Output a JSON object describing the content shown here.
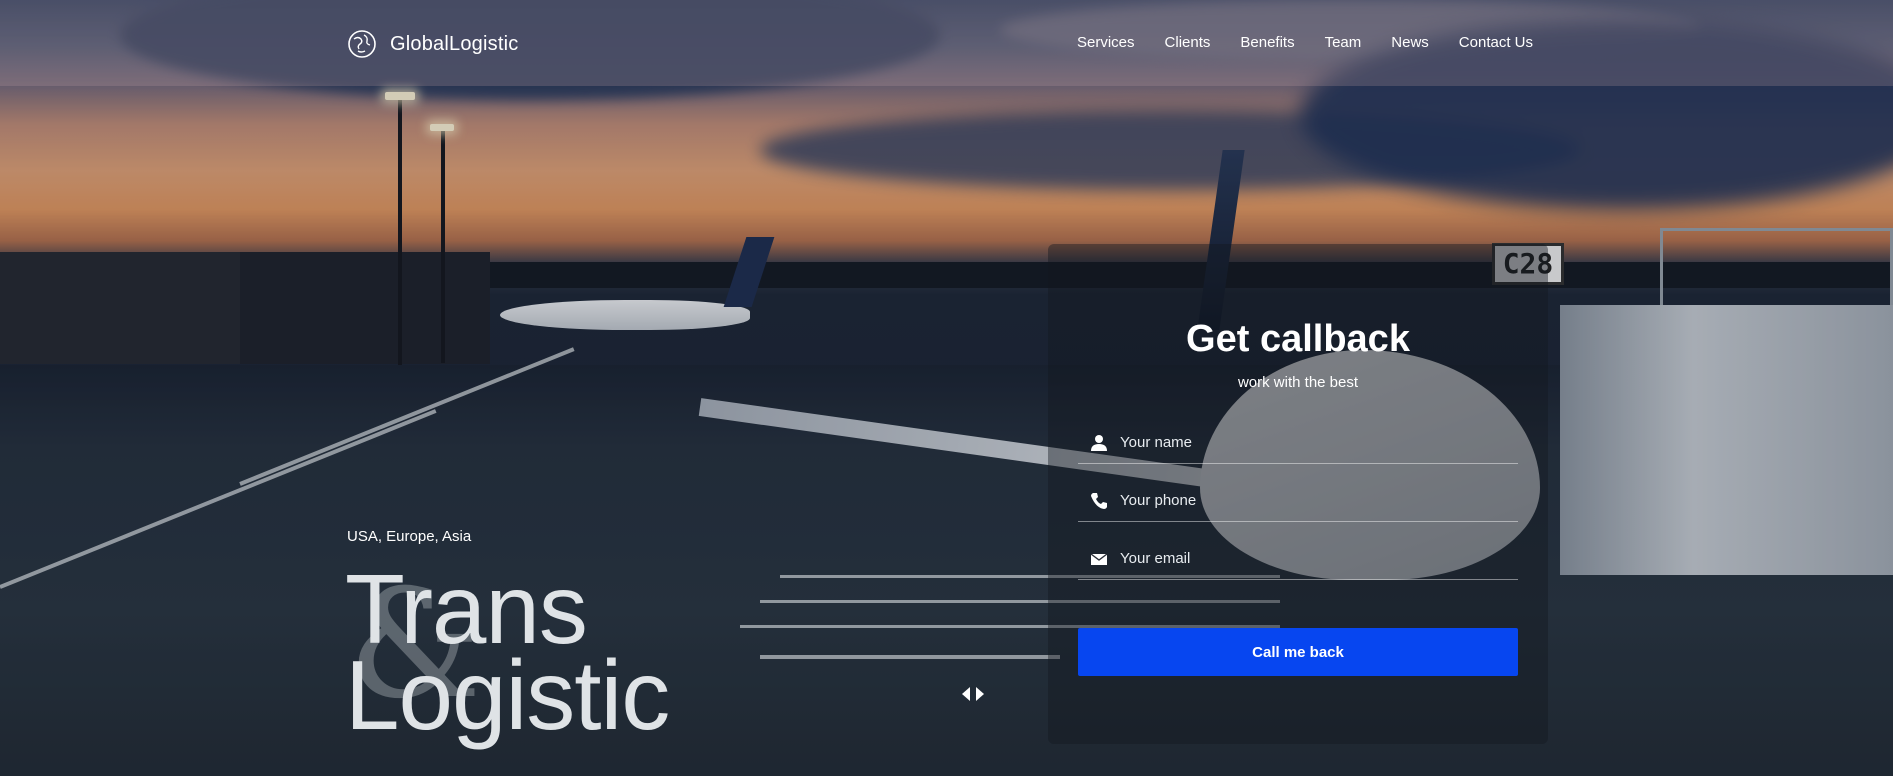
{
  "brand": {
    "name": "GlobalLogistic",
    "logo_icon": "globe-logo-icon"
  },
  "nav": {
    "items": [
      {
        "label": "Services"
      },
      {
        "label": "Clients"
      },
      {
        "label": "Benefits"
      },
      {
        "label": "Team"
      },
      {
        "label": "News"
      },
      {
        "label": "Contact Us"
      }
    ]
  },
  "hero": {
    "region": "USA, Europe, Asia",
    "headline_line1": "Trans",
    "ampersand": "&",
    "headline_line2": "Logistic",
    "gate_sign": "C28"
  },
  "callback": {
    "title": "Get callback",
    "subtitle": "work with the best",
    "name_placeholder": "Your name",
    "phone_placeholder": "Your phone",
    "email_placeholder": "Your email",
    "button_label": "Call me back",
    "button_color": "#0746f0"
  },
  "icons": {
    "name": "user-icon",
    "phone": "phone-icon",
    "email": "envelope-icon",
    "prev": "arrow-left-icon",
    "next": "arrow-right-icon"
  }
}
